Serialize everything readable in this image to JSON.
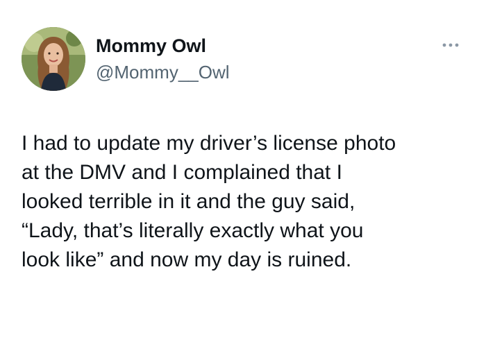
{
  "author": {
    "display_name": "Mommy Owl",
    "handle": "@Mommy__Owl",
    "avatar_icon": "profile-photo"
  },
  "menu": {
    "icon": "more-horizontal-icon"
  },
  "tweet": {
    "lines": [
      "I had to update my driver’s license photo",
      "at the DMV and I complained that I",
      "looked terrible in it and the guy said,",
      "“Lady, that’s literally exactly what you",
      "look like” and now my day is ruined."
    ]
  },
  "colors": {
    "text_primary": "#0f1419",
    "text_secondary": "#536471",
    "icon_gray": "#8b98a5",
    "background": "#ffffff"
  }
}
